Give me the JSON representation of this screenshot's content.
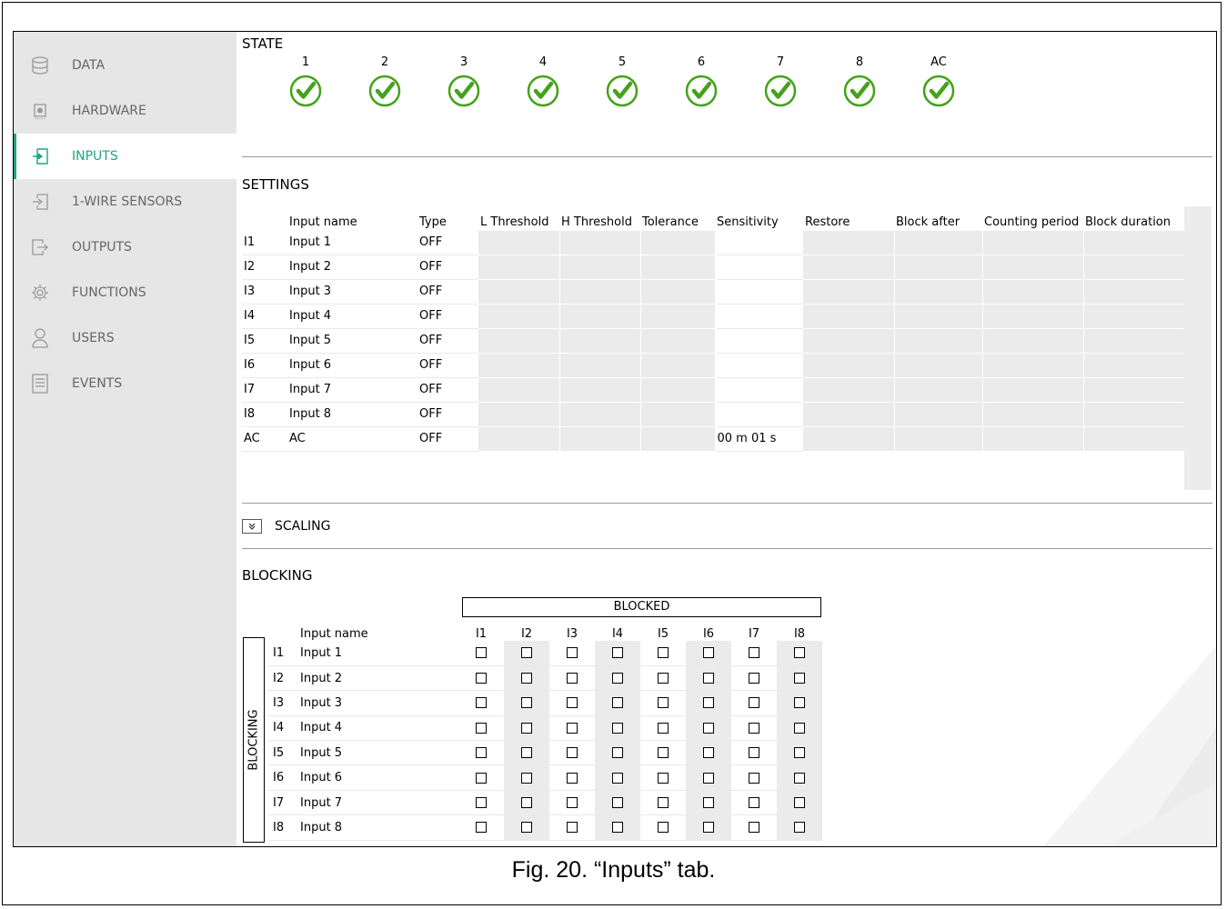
{
  "sidebar": {
    "items": [
      {
        "label": "DATA",
        "icon": "database-icon"
      },
      {
        "label": "HARDWARE",
        "icon": "chip-icon"
      },
      {
        "label": "INPUTS",
        "icon": "input-icon",
        "active": true
      },
      {
        "label": "1-WIRE SENSORS",
        "icon": "sensor-input-icon"
      },
      {
        "label": "OUTPUTS",
        "icon": "output-icon"
      },
      {
        "label": "FUNCTIONS",
        "icon": "gear-icon"
      },
      {
        "label": "USERS",
        "icon": "user-icon"
      },
      {
        "label": "EVENTS",
        "icon": "document-icon"
      }
    ]
  },
  "state": {
    "title": "STATE",
    "columns": [
      "1",
      "2",
      "3",
      "4",
      "5",
      "6",
      "7",
      "8",
      "AC"
    ]
  },
  "settings": {
    "title": "SETTINGS",
    "headers": [
      "",
      "Input name",
      "Type",
      "L Threshold",
      "H Threshold",
      "Tolerance",
      "Sensitivity",
      "Restore",
      "Block after",
      "Counting period",
      "Block duration"
    ],
    "rows": [
      {
        "id": "I1",
        "name": "Input 1",
        "type": "OFF",
        "sensitivity": ""
      },
      {
        "id": "I2",
        "name": "Input 2",
        "type": "OFF",
        "sensitivity": ""
      },
      {
        "id": "I3",
        "name": "Input 3",
        "type": "OFF",
        "sensitivity": ""
      },
      {
        "id": "I4",
        "name": "Input 4",
        "type": "OFF",
        "sensitivity": ""
      },
      {
        "id": "I5",
        "name": "Input 5",
        "type": "OFF",
        "sensitivity": ""
      },
      {
        "id": "I6",
        "name": "Input 6",
        "type": "OFF",
        "sensitivity": ""
      },
      {
        "id": "I7",
        "name": "Input 7",
        "type": "OFF",
        "sensitivity": ""
      },
      {
        "id": "I8",
        "name": "Input 8",
        "type": "OFF",
        "sensitivity": ""
      },
      {
        "id": "AC",
        "name": "AC",
        "type": "OFF",
        "sensitivity": "00 m 01 s"
      }
    ]
  },
  "scaling": {
    "label": "SCALING",
    "icon": "expand-chevron-icon"
  },
  "blocking": {
    "title": "BLOCKING",
    "header": "BLOCKED",
    "side_label": "BLOCKING",
    "name_header": "Input name",
    "columns": [
      "I1",
      "I2",
      "I3",
      "I4",
      "I5",
      "I6",
      "I7",
      "I8"
    ],
    "rows": [
      {
        "id": "I1",
        "name": "Input 1"
      },
      {
        "id": "I2",
        "name": "Input 2"
      },
      {
        "id": "I3",
        "name": "Input 3"
      },
      {
        "id": "I4",
        "name": "Input 4"
      },
      {
        "id": "I5",
        "name": "Input 5"
      },
      {
        "id": "I6",
        "name": "Input 6"
      },
      {
        "id": "I7",
        "name": "Input 7"
      },
      {
        "id": "I8",
        "name": "Input 8"
      }
    ]
  },
  "caption": "Fig. 20. “Inputs” tab.",
  "colors": {
    "accent": "#1aa585",
    "check": "#45a21a",
    "sidebar_bg": "#e6e6e6",
    "cell_gray": "#ebebeb"
  }
}
